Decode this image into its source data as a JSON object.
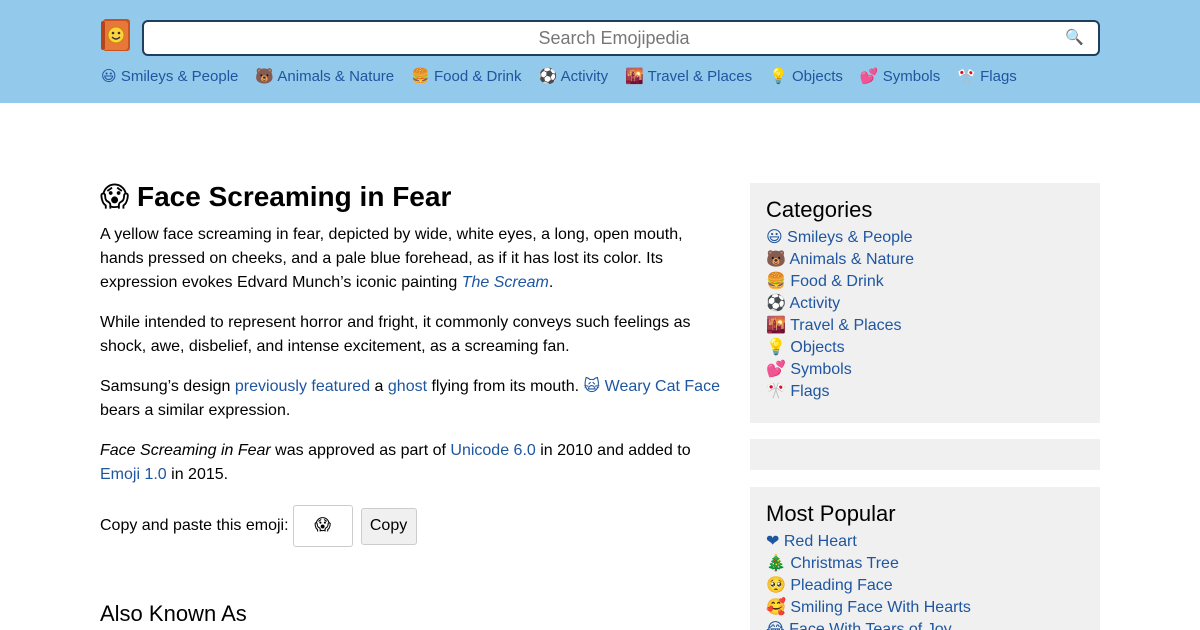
{
  "header": {
    "search_placeholder": "Search Emojipedia",
    "search_glyph": "🔍",
    "nav": [
      {
        "glyph": "😃",
        "label": "Smileys & People"
      },
      {
        "glyph": "🐻",
        "label": "Animals & Nature"
      },
      {
        "glyph": "🍔",
        "label": "Food & Drink"
      },
      {
        "glyph": "⚽",
        "label": "Activity"
      },
      {
        "glyph": "🌇",
        "label": "Travel & Places"
      },
      {
        "glyph": "💡",
        "label": "Objects"
      },
      {
        "glyph": "💕",
        "label": "Symbols"
      },
      {
        "glyph": "🎌",
        "label": "Flags"
      }
    ]
  },
  "article": {
    "emoji": "😱",
    "title": "Face Screaming in Fear",
    "p1_text": "A yellow face screaming in fear, depicted by wide, white eyes, a long, open mouth, hands pressed on cheeks, and a pale blue forehead, as if it has lost its color. Its expression evokes Edvard Munch’s iconic painting ",
    "p1_link": "The Scream",
    "p1_end": ".",
    "p2": "While intended to represent horror and fright, it commonly conveys such feelings as shock, awe, disbelief, and intense excitement, as a screaming fan.",
    "p3_a": "Samsung’s design ",
    "p3_link1": "previously featured",
    "p3_b": " a ",
    "p3_link2": "ghost",
    "p3_c": " flying from its mouth. ",
    "p3_link3_glyph": "🙀",
    "p3_link3": "Weary Cat Face",
    "p3_d": " bears a similar expression.",
    "p4_em": "Face Screaming in Fear",
    "p4_a": " was approved as part of ",
    "p4_link1": "Unicode 6.0",
    "p4_b": " in 2010 and added to ",
    "p4_link2": "Emoji 1.0",
    "p4_c": " in 2015.",
    "copy_label": "Copy and paste this emoji:",
    "copy_value": "😱",
    "copy_button": "Copy",
    "aka_heading": "Also Known As"
  },
  "sidebar": {
    "categories_title": "Categories",
    "categories": [
      {
        "glyph": "😃",
        "label": "Smileys & People"
      },
      {
        "glyph": "🐻",
        "label": "Animals & Nature"
      },
      {
        "glyph": "🍔",
        "label": "Food & Drink"
      },
      {
        "glyph": "⚽",
        "label": "Activity"
      },
      {
        "glyph": "🌇",
        "label": "Travel & Places"
      },
      {
        "glyph": "💡",
        "label": "Objects"
      },
      {
        "glyph": "💕",
        "label": "Symbols"
      },
      {
        "glyph": "🎌",
        "label": "Flags"
      }
    ],
    "popular_title": "Most Popular",
    "popular": [
      {
        "glyph": "❤",
        "label": "Red Heart"
      },
      {
        "glyph": "🎄",
        "label": "Christmas Tree"
      },
      {
        "glyph": "🥺",
        "label": "Pleading Face"
      },
      {
        "glyph": "🥰",
        "label": "Smiling Face With Hearts"
      },
      {
        "glyph": "😂",
        "label": "Face With Tears of Joy"
      }
    ]
  }
}
